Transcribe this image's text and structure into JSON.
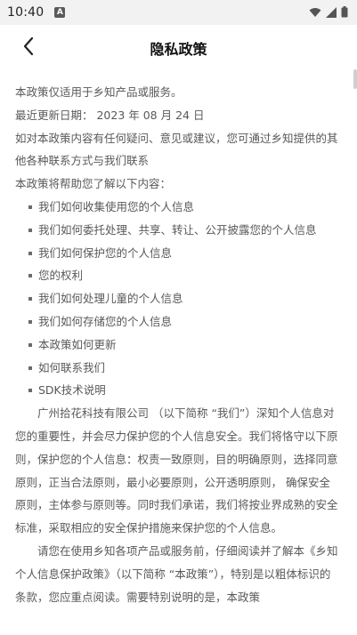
{
  "status": {
    "time": "10:40",
    "app_icon": "A"
  },
  "nav": {
    "title": "隐私政策"
  },
  "doc": {
    "intro": "本政策仅适用于乡知产品或服务。",
    "updated": "最近更新日期： 2023 年 08 月 24 日",
    "contact": "如对本政策内容有任何疑问、意见或建议，您可通过乡知提供的其他各种联系方式与我们联系",
    "toc_heading": "本政策将帮助您了解以下内容：",
    "toc": [
      "我们如何收集使用您的个人信息",
      "我们如何委托处理、共享、转让、公开披露您的个人信息",
      "我们如何保护您的个人信息",
      "您的权利",
      "我们如何处理儿童的个人信息",
      "我们如何存储您的个人信息",
      "本政策如何更新",
      "如何联系我们",
      "SDK技术说明"
    ],
    "para1": "广州拾花科技有限公司 （以下简称 “我们”）深知个人信息对您的重要性，并会尽力保护您的个人信息安全。我们将恪守以下原则，保护您的个人信息：权责一致原则，目的明确原则，选择同意原则，正当合法原则，最小必要原则，公开透明原则， 确保安全原则，主体参与原则等。同时我们承诺，我们将按业界成熟的安全标准，采取相应的安全保护措施来保护您的个人信息。",
    "para2": "请您在使用乡知各项产品或服务前，仔细阅读并了解本《乡知个人信息保护政策》（以下简称 “本政策”），特别是以粗体标识的条款，您应重点阅读。需要特别说明的是，本政策"
  },
  "icons": {
    "wifi": "wifi-icon",
    "signal": "signal-icon",
    "battery": "battery-icon",
    "back": "chevron-left-icon"
  }
}
